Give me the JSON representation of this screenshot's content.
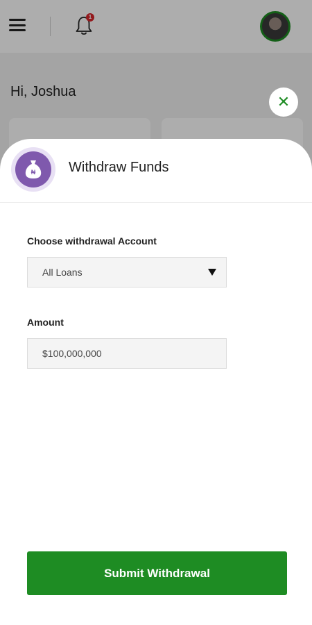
{
  "header": {
    "notification_count": "1",
    "greeting": "Hi, Joshua"
  },
  "sheet": {
    "title": "Withdraw Funds",
    "account_label": "Choose withdrawal Account",
    "account_value": "All Loans",
    "amount_label": "Amount",
    "amount_value": "$100,000,000",
    "submit_label": "Submit Withdrawal"
  },
  "colors": {
    "accent_green": "#1e8c23",
    "icon_purple": "#7f59ad",
    "badge_red": "#d9262b"
  },
  "icons": {
    "menu": "hamburger-icon",
    "notifications": "bell-icon",
    "close": "close-icon",
    "money": "money-bag-icon",
    "dropdown": "caret-down-icon"
  }
}
